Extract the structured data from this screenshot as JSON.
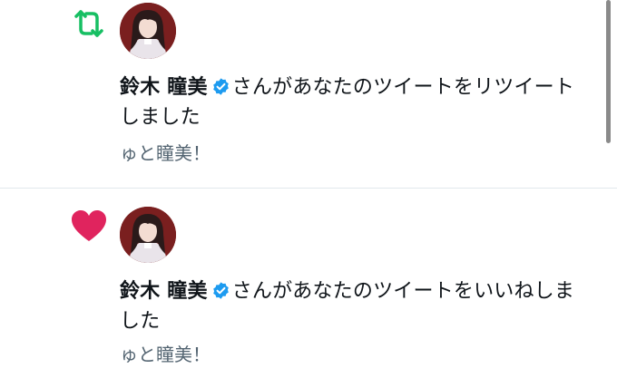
{
  "notifications": [
    {
      "type_icon": "retweet-icon",
      "icon_color": "#17bf63",
      "user_name": "鈴木 瞳美",
      "verified": true,
      "action_text": "さんがあなたのツイートをリツイートしました",
      "tweet_preview": "ゅと瞳美！"
    },
    {
      "type_icon": "heart-icon",
      "icon_color": "#e0245e",
      "user_name": "鈴木 瞳美",
      "verified": true,
      "action_text": "さんがあなたのツイートをいいねしました",
      "tweet_preview": "ゅと瞳美！"
    }
  ],
  "colors": {
    "verified_badge": "#1d9bf0",
    "secondary_text": "#536471",
    "avatar_background": "#7a1f1f"
  }
}
